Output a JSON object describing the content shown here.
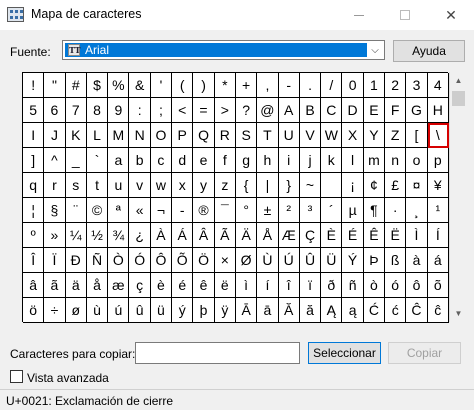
{
  "window": {
    "title": "Mapa de caracteres",
    "minimize_label": "—",
    "close_label": "✕"
  },
  "font": {
    "label": "Fuente:",
    "selected": "Arial",
    "icon": "truetype-font-icon"
  },
  "help_button": "Ayuda",
  "grid": {
    "selected_index": 59,
    "rows": [
      [
        "!",
        "\"",
        "#",
        "$",
        "%",
        "&",
        "'",
        "(",
        ")",
        "*",
        "+",
        ",",
        "-",
        ".",
        "/",
        "0",
        "1",
        "2",
        "3",
        "4"
      ],
      [
        "5",
        "6",
        "7",
        "8",
        "9",
        ":",
        ";",
        "<",
        "=",
        ">",
        "?",
        "@",
        "A",
        "B",
        "C",
        "D",
        "E",
        "F",
        "G",
        "H"
      ],
      [
        "I",
        "J",
        "K",
        "L",
        "M",
        "N",
        "O",
        "P",
        "Q",
        "R",
        "S",
        "T",
        "U",
        "V",
        "W",
        "X",
        "Y",
        "Z",
        "[",
        "\\"
      ],
      [
        "]",
        "^",
        "_",
        "`",
        "a",
        "b",
        "c",
        "d",
        "e",
        "f",
        "g",
        "h",
        "i",
        "j",
        "k",
        "l",
        "m",
        "n",
        "o",
        "p"
      ],
      [
        "q",
        "r",
        "s",
        "t",
        "u",
        "v",
        "w",
        "x",
        "y",
        "z",
        "{",
        "|",
        "}",
        "~",
        " ",
        "¡",
        "¢",
        "£",
        "¤",
        "¥"
      ],
      [
        "¦",
        "§",
        "¨",
        "©",
        "ª",
        "«",
        "¬",
        "-",
        "®",
        "¯",
        "°",
        "±",
        "²",
        "³",
        "´",
        "µ",
        "¶",
        "·",
        "¸",
        "¹"
      ],
      [
        "º",
        "»",
        "¼",
        "½",
        "¾",
        "¿",
        "À",
        "Á",
        "Â",
        "Ã",
        "Ä",
        "Å",
        "Æ",
        "Ç",
        "È",
        "É",
        "Ê",
        "Ë",
        "Ì",
        "Í"
      ],
      [
        "Î",
        "Ï",
        "Ð",
        "Ñ",
        "Ò",
        "Ó",
        "Ô",
        "Õ",
        "Ö",
        "×",
        "Ø",
        "Ù",
        "Ú",
        "Û",
        "Ü",
        "Ý",
        "Þ",
        "ß",
        "à",
        "á"
      ],
      [
        "â",
        "ã",
        "ä",
        "å",
        "æ",
        "ç",
        "è",
        "é",
        "ê",
        "ë",
        "ì",
        "í",
        "î",
        "ï",
        "ð",
        "ñ",
        "ò",
        "ó",
        "ô",
        "õ"
      ],
      [
        "ö",
        "÷",
        "ø",
        "ù",
        "ú",
        "û",
        "ü",
        "ý",
        "þ",
        "ÿ",
        "Ā",
        "ā",
        "Ă",
        "ă",
        "Ą",
        "ą",
        "Ć",
        "ć",
        "Ĉ",
        "ĉ"
      ]
    ]
  },
  "copy": {
    "label": "Caracteres para copiar:",
    "value": "",
    "select_button": "Seleccionar",
    "copy_button": "Copiar"
  },
  "advanced": {
    "label": "Vista avanzada",
    "checked": false
  },
  "status": "U+0021: Exclamación de cierre",
  "colors": {
    "selection_blue": "#0078d7",
    "highlight_red": "#d60000"
  }
}
